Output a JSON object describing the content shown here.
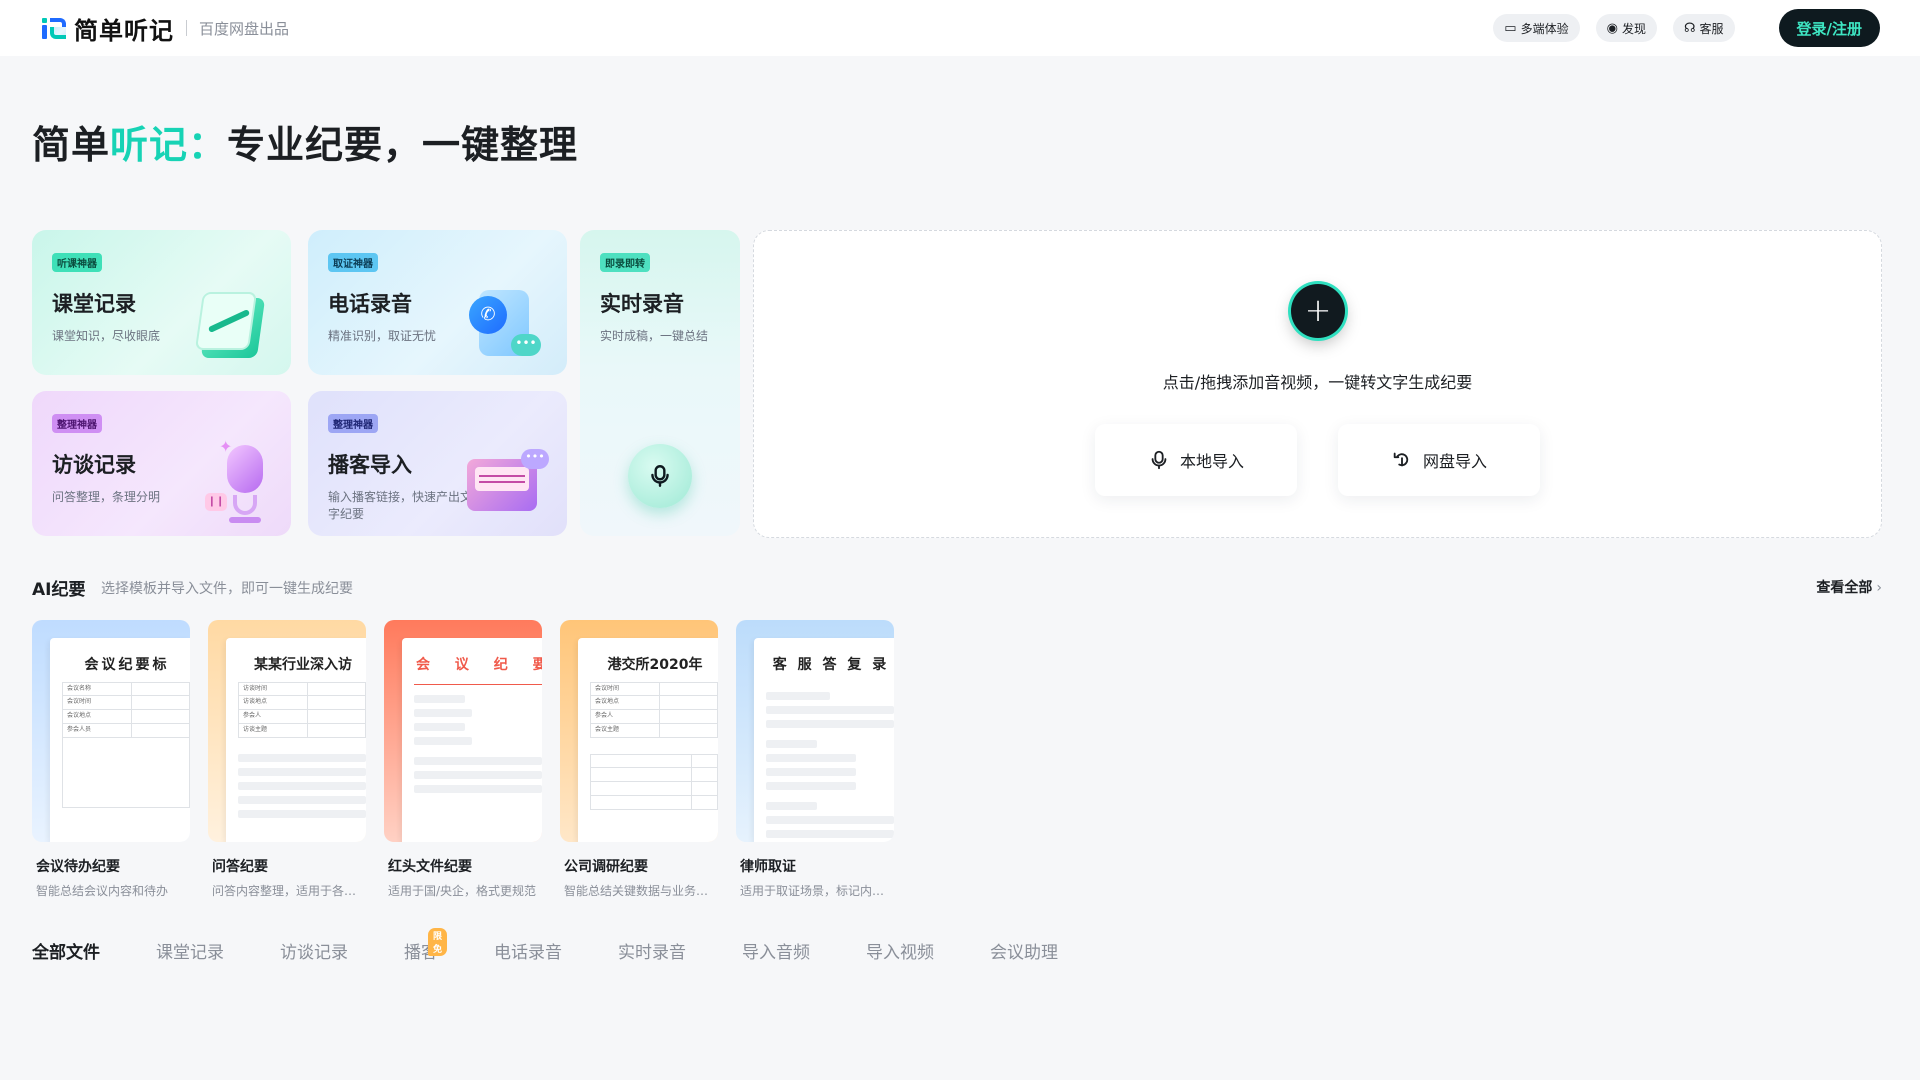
{
  "header": {
    "logo_text": "简单听记",
    "logo_sub": "百度网盘出品",
    "multi_device": "多端体验",
    "discover": "发现",
    "service": "客服",
    "login": "登录/注册"
  },
  "hero": {
    "title_part1": "简单",
    "title_accent": "听记：",
    "title_part2": "专业纪要，一键整理"
  },
  "cards": [
    {
      "tag": "听课神器",
      "title": "课堂记录",
      "desc": "课堂知识，尽收眼底"
    },
    {
      "tag": "取证神器",
      "title": "电话录音",
      "desc": "精准识别，取证无忧"
    },
    {
      "tag": "即录即转",
      "title": "实时录音",
      "desc": "实时成稿，一键总结"
    },
    {
      "tag": "整理神器",
      "title": "访谈记录",
      "desc": "问答整理，条理分明"
    },
    {
      "tag": "整理神器",
      "title": "播客导入",
      "desc": "输入播客链接，快速产出文字纪要"
    }
  ],
  "upload": {
    "hint": "点击/拖拽添加音视频，一键转文字生成纪要",
    "local_import": "本地导入",
    "pan_import": "网盘导入"
  },
  "ai_section": {
    "title": "AI纪要",
    "subtitle": "选择模板并导入文件，即可一键生成纪要",
    "view_all": "查看全部"
  },
  "templates": [
    {
      "paper_title": "会议纪要标",
      "name": "会议待办纪要",
      "desc": "智能总结会议内容和待办",
      "rows": [
        "会议名称",
        "会议时间",
        "会议地点",
        "参会人员"
      ]
    },
    {
      "paper_title": "某某行业深入访",
      "name": "问答纪要",
      "desc": "问答内容整理，适用于各类...",
      "rows": [
        "访谈时间",
        "访谈地点",
        "参会人",
        "访谈主题"
      ]
    },
    {
      "paper_title": "会 议 纪 要",
      "name": "红头文件纪要",
      "desc": "适用于国/央企，格式更规范",
      "rows": []
    },
    {
      "paper_title": "港交所2020年",
      "name": "公司调研纪要",
      "desc": "智能总结关键数据与业务信息",
      "rows": [
        "会议时间",
        "会议地点",
        "参会人",
        "会议主题"
      ]
    },
    {
      "paper_title": "客 服 答 复 录",
      "name": "律师取证",
      "desc": "适用于取证场景，标记内容...",
      "rows": []
    }
  ],
  "tabs": {
    "all": "全部文件",
    "class": "课堂记录",
    "interview": "访谈记录",
    "podcast": "播客",
    "podcast_badge": "限免",
    "phone": "电话录音",
    "realtime": "实时录音",
    "audio": "导入音频",
    "video": "导入视频",
    "meeting": "会议助理"
  }
}
